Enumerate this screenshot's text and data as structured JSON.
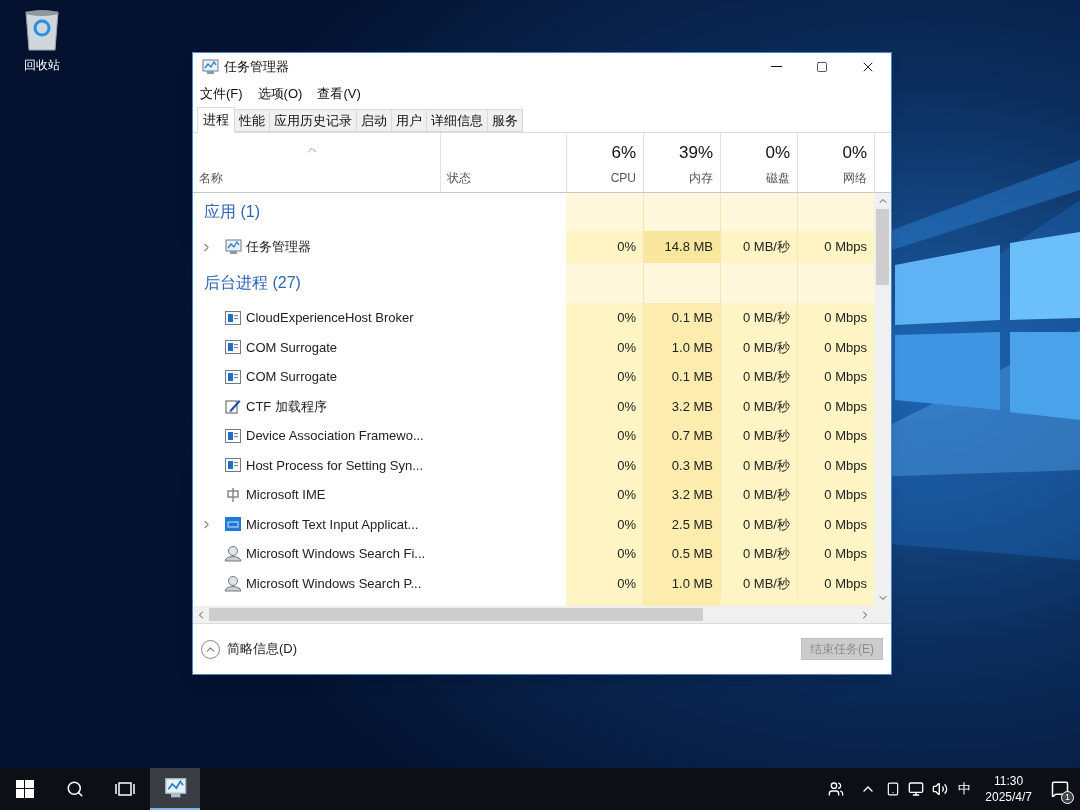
{
  "desktop_icons": [
    {
      "label": "回收站"
    }
  ],
  "window": {
    "title": "任务管理器",
    "menu": [
      "文件(F)",
      "选项(O)",
      "查看(V)"
    ],
    "tabs": [
      {
        "label": "进程",
        "selected": true
      },
      {
        "label": "性能",
        "selected": false
      },
      {
        "label": "应用历史记录",
        "selected": false
      },
      {
        "label": "启动",
        "selected": false
      },
      {
        "label": "用户",
        "selected": false
      },
      {
        "label": "详细信息",
        "selected": false
      },
      {
        "label": "服务",
        "selected": false
      }
    ],
    "columns": [
      {
        "label": "名称",
        "sorted": true
      },
      {
        "label": "状态",
        "sorted": false
      },
      {
        "value": "6%",
        "label": "CPU",
        "sorted": false
      },
      {
        "value": "39%",
        "label": "内存",
        "sorted": false
      },
      {
        "value": "0%",
        "label": "磁盘",
        "sorted": false
      },
      {
        "value": "0%",
        "label": "网络",
        "sorted": false
      }
    ],
    "groups": [
      {
        "title": "应用 (1)",
        "rows": [
          {
            "kind": "monitor",
            "expandable": true,
            "name": "任务管理器",
            "cpu": "0%",
            "memory": "14.8 MB",
            "disk": "0 MB/秒",
            "network": "0 Mbps"
          }
        ]
      },
      {
        "title": "后台进程 (27)",
        "rows": [
          {
            "kind": "window",
            "expandable": false,
            "name": "CloudExperienceHost Broker",
            "cpu": "0%",
            "memory": "0.1 MB",
            "disk": "0 MB/秒",
            "network": "0 Mbps"
          },
          {
            "kind": "window",
            "expandable": false,
            "name": "COM Surrogate",
            "cpu": "0%",
            "memory": "1.0 MB",
            "disk": "0 MB/秒",
            "network": "0 Mbps"
          },
          {
            "kind": "window",
            "expandable": false,
            "name": "COM Surrogate",
            "cpu": "0%",
            "memory": "0.1 MB",
            "disk": "0 MB/秒",
            "network": "0 Mbps"
          },
          {
            "kind": "pen",
            "expandable": false,
            "name": "CTF 加载程序",
            "cpu": "0%",
            "memory": "3.2 MB",
            "disk": "0 MB/秒",
            "network": "0 Mbps"
          },
          {
            "kind": "window",
            "expandable": false,
            "name": "Device Association Framewo...",
            "cpu": "0%",
            "memory": "0.7 MB",
            "disk": "0 MB/秒",
            "network": "0 Mbps"
          },
          {
            "kind": "window",
            "expandable": false,
            "name": "Host Process for Setting Syn...",
            "cpu": "0%",
            "memory": "0.3 MB",
            "disk": "0 MB/秒",
            "network": "0 Mbps"
          },
          {
            "kind": "ime",
            "expandable": false,
            "name": "Microsoft IME",
            "cpu": "0%",
            "memory": "3.2 MB",
            "disk": "0 MB/秒",
            "network": "0 Mbps"
          },
          {
            "kind": "keyboard",
            "expandable": true,
            "name": "Microsoft Text Input Applicat...",
            "cpu": "0%",
            "memory": "2.5 MB",
            "disk": "0 MB/秒",
            "network": "0 Mbps"
          },
          {
            "kind": "user",
            "expandable": false,
            "name": "Microsoft Windows Search Fi...",
            "cpu": "0%",
            "memory": "0.5 MB",
            "disk": "0 MB/秒",
            "network": "0 Mbps"
          },
          {
            "kind": "user",
            "expandable": false,
            "name": "Microsoft Windows Search P...",
            "cpu": "0%",
            "memory": "1.0 MB",
            "disk": "0 MB/秒",
            "network": "0 Mbps"
          }
        ]
      }
    ],
    "footer": {
      "details_label": "简略信息(D)",
      "end_task": {
        "label": "结束任务(E)",
        "disabled": true
      }
    }
  },
  "taskbar": {
    "apps": [
      {
        "kind": "task-manager",
        "selected": true
      }
    ],
    "ime": "中",
    "time": "11:30",
    "date": "2025/4/7",
    "notifications": "1"
  }
}
